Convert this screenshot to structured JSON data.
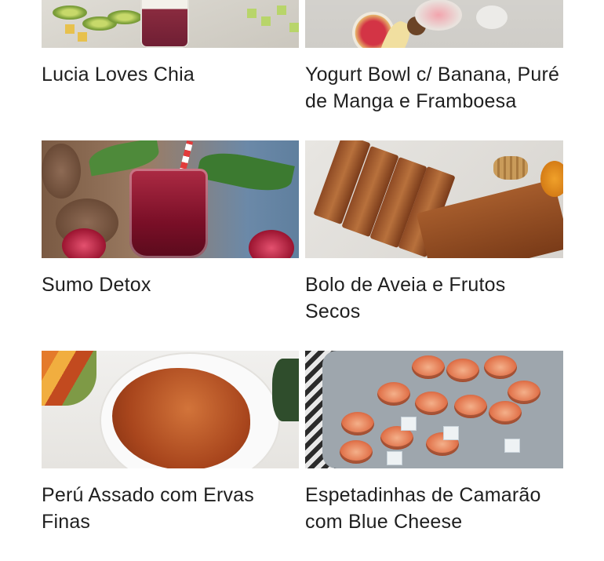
{
  "cards": [
    {
      "title": "Lucia Loves Chia"
    },
    {
      "title": "Yogurt Bowl c/ Banana, Puré de Manga e Framboesa"
    },
    {
      "title": "Sumo Detox"
    },
    {
      "title": "Bolo de Aveia e Frutos Secos"
    },
    {
      "title": "Perú Assado com Ervas Finas"
    },
    {
      "title": "Espetadinhas de Camarão com Blue Cheese"
    }
  ]
}
